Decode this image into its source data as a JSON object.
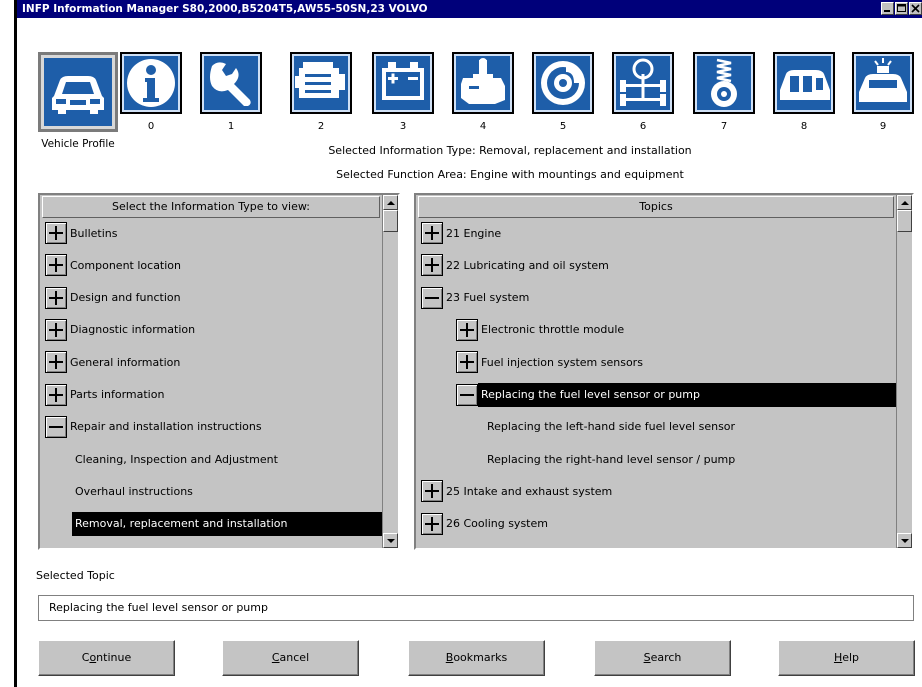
{
  "window": {
    "title": "INFP Information Manager S80,2000,B5204T5,AW55-50SN,23 VOLVO"
  },
  "icons": [
    {
      "id": "vehicle-profile",
      "label": "Vehicle Profile",
      "icon": "car-icon"
    },
    {
      "id": "0",
      "label": "0",
      "icon": "info-icon"
    },
    {
      "id": "1",
      "label": "1",
      "icon": "wrench-icon"
    },
    {
      "id": "2",
      "label": "2",
      "icon": "engine-icon"
    },
    {
      "id": "3",
      "label": "3",
      "icon": "battery-icon"
    },
    {
      "id": "4",
      "label": "4",
      "icon": "gearbox-icon"
    },
    {
      "id": "5",
      "label": "5",
      "icon": "brake-icon"
    },
    {
      "id": "6",
      "label": "6",
      "icon": "steering-suspension-icon"
    },
    {
      "id": "7",
      "label": "7",
      "icon": "spring-wheel-icon"
    },
    {
      "id": "8",
      "label": "8",
      "icon": "car-body-icon"
    },
    {
      "id": "9",
      "label": "9",
      "icon": "emergency-car-icon"
    }
  ],
  "selected_info_type": "Selected Information Type: Removal, replacement and installation",
  "selected_function_area": "Selected Function Area: Engine with mountings and equipment",
  "left_panel": {
    "header": "Select the Information Type to view:",
    "items": [
      {
        "label": "Bulletins",
        "toggle": "plus"
      },
      {
        "label": "Component location",
        "toggle": "plus"
      },
      {
        "label": "Design and function",
        "toggle": "plus"
      },
      {
        "label": "Diagnostic information",
        "toggle": "plus"
      },
      {
        "label": "General information",
        "toggle": "plus"
      },
      {
        "label": "Parts information",
        "toggle": "plus"
      },
      {
        "label": "Repair and installation instructions",
        "toggle": "minus"
      },
      {
        "label": "Cleaning, Inspection and Adjustment",
        "toggle": "none"
      },
      {
        "label": "Overhaul instructions",
        "toggle": "none"
      },
      {
        "label": "Removal, replacement and installation",
        "toggle": "none",
        "selected": true
      }
    ]
  },
  "right_panel": {
    "header": "Topics",
    "items": [
      {
        "label": "21 Engine",
        "toggle": "plus",
        "level": 0
      },
      {
        "label": "22 Lubricating and oil system",
        "toggle": "plus",
        "level": 0
      },
      {
        "label": "23 Fuel system",
        "toggle": "minus",
        "level": 0
      },
      {
        "label": "Electronic throttle module",
        "toggle": "plus",
        "level": 1
      },
      {
        "label": "Fuel injection system sensors",
        "toggle": "plus",
        "level": 1
      },
      {
        "label": "Replacing the fuel level sensor or pump",
        "toggle": "minus",
        "level": 1,
        "selected": true
      },
      {
        "label": "Replacing the left-hand side fuel level sensor",
        "toggle": "none",
        "level": 2
      },
      {
        "label": "Replacing the right-hand level sensor / pump",
        "toggle": "none",
        "level": 2
      },
      {
        "label": "25 Intake and exhaust system",
        "toggle": "plus",
        "level": 0
      },
      {
        "label": "26 Cooling system",
        "toggle": "plus",
        "level": 0
      }
    ]
  },
  "selected_topic": {
    "label": "Selected Topic",
    "value": "Replacing the fuel level sensor or pump"
  },
  "buttons": [
    {
      "label": "Continue",
      "accel": "o"
    },
    {
      "label": "Cancel",
      "accel": "C"
    },
    {
      "label": "Bookmarks",
      "accel": "B"
    },
    {
      "label": "Search",
      "accel": "S"
    },
    {
      "label": "Help",
      "accel": "H"
    }
  ],
  "colors": {
    "titlebar": "#00007a",
    "icon_bg": "#1e5ea9",
    "panel_bg": "#c4c4c4",
    "selection": "#000000"
  }
}
